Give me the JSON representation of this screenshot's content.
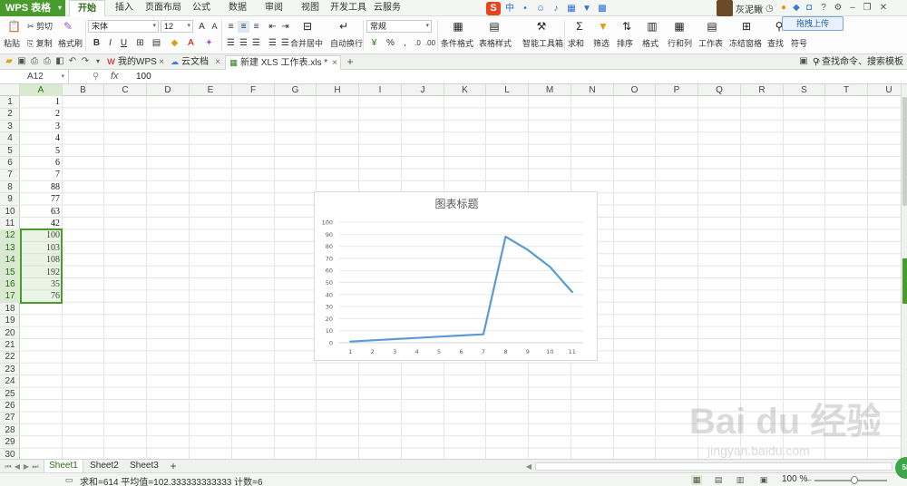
{
  "app": {
    "name": "WPS 表格"
  },
  "menu": {
    "tabs": [
      "开始",
      "插入",
      "页面布局",
      "公式",
      "数据",
      "审阅",
      "视图",
      "开发工具",
      "云服务"
    ],
    "active": 0
  },
  "user": {
    "name": "灰泥鳅"
  },
  "upload_label": "拖拽上传",
  "ribbon": {
    "paste": "粘贴",
    "cut": "剪切",
    "copy": "复制",
    "format_painter": "格式刷",
    "font_name": "宋体",
    "font_size": "12",
    "merge": "合并居中",
    "wrap": "自动换行",
    "number_format": "常规",
    "cond_format": "条件格式",
    "table_style": "表格样式",
    "smart_toolbox": "智能工具箱",
    "sum": "求和",
    "filter": "筛选",
    "sort": "排序",
    "format": "格式",
    "rowcol": "行和列",
    "worksheet": "工作表",
    "freeze": "冻结窗格",
    "find": "查找",
    "symbol": "符号"
  },
  "doc_tabs": [
    {
      "label": "我的WPS",
      "active": false
    },
    {
      "label": "云文档",
      "active": false
    },
    {
      "label": "新建 XLS 工作表.xls *",
      "active": true
    }
  ],
  "command_search": "查找命令、搜索模板",
  "formula_bar": {
    "cell_ref": "A12",
    "fx": "fx",
    "value": "100"
  },
  "columns": [
    "A",
    "B",
    "C",
    "D",
    "E",
    "F",
    "G",
    "H",
    "I",
    "J",
    "K",
    "L",
    "M",
    "N",
    "O",
    "P",
    "Q",
    "R",
    "S",
    "T",
    "U"
  ],
  "rows": [
    "1",
    "2",
    "3",
    "4",
    "5",
    "6",
    "7",
    "8",
    "9",
    "10",
    "11",
    "12",
    "13",
    "14",
    "15",
    "16",
    "17",
    "18",
    "19",
    "20",
    "21",
    "22",
    "23",
    "24",
    "25",
    "26",
    "27",
    "28",
    "29",
    "30"
  ],
  "column_a": [
    "1",
    "2",
    "3",
    "4",
    "5",
    "6",
    "7",
    "88",
    "77",
    "63",
    "42",
    "100",
    "103",
    "108",
    "192",
    "35",
    "76"
  ],
  "selection": {
    "column": "A",
    "first_row": 12,
    "last_row": 17
  },
  "chart_data": {
    "type": "line",
    "title": "图表标题",
    "categories": [
      "1",
      "2",
      "3",
      "4",
      "5",
      "6",
      "7",
      "8",
      "9",
      "10",
      "11"
    ],
    "series": [
      {
        "values": [
          1,
          2,
          3,
          4,
          5,
          6,
          7,
          88,
          77,
          63,
          42
        ]
      }
    ],
    "ylim": [
      0,
      100
    ],
    "yticks": [
      "0",
      "10",
      "20",
      "30",
      "40",
      "50",
      "60",
      "70",
      "80",
      "90",
      "100"
    ],
    "grid": true,
    "legend": "none",
    "line_color": "#5b9bd5"
  },
  "sheets": [
    {
      "label": "Sheet1",
      "active": true
    },
    {
      "label": "Sheet2",
      "active": false
    },
    {
      "label": "Sheet3",
      "active": false
    }
  ],
  "status": {
    "text": "求和=614  平均值=102.333333333333  计数=6",
    "zoom": "100 %"
  },
  "colors": {
    "accent": "#4a9b2e",
    "selection": "#d9ead0",
    "line": "#5b9bd5"
  },
  "watermark": {
    "text": "Bai du 经验",
    "sub": "jingyan.baidu.com"
  },
  "fab_label": "58"
}
